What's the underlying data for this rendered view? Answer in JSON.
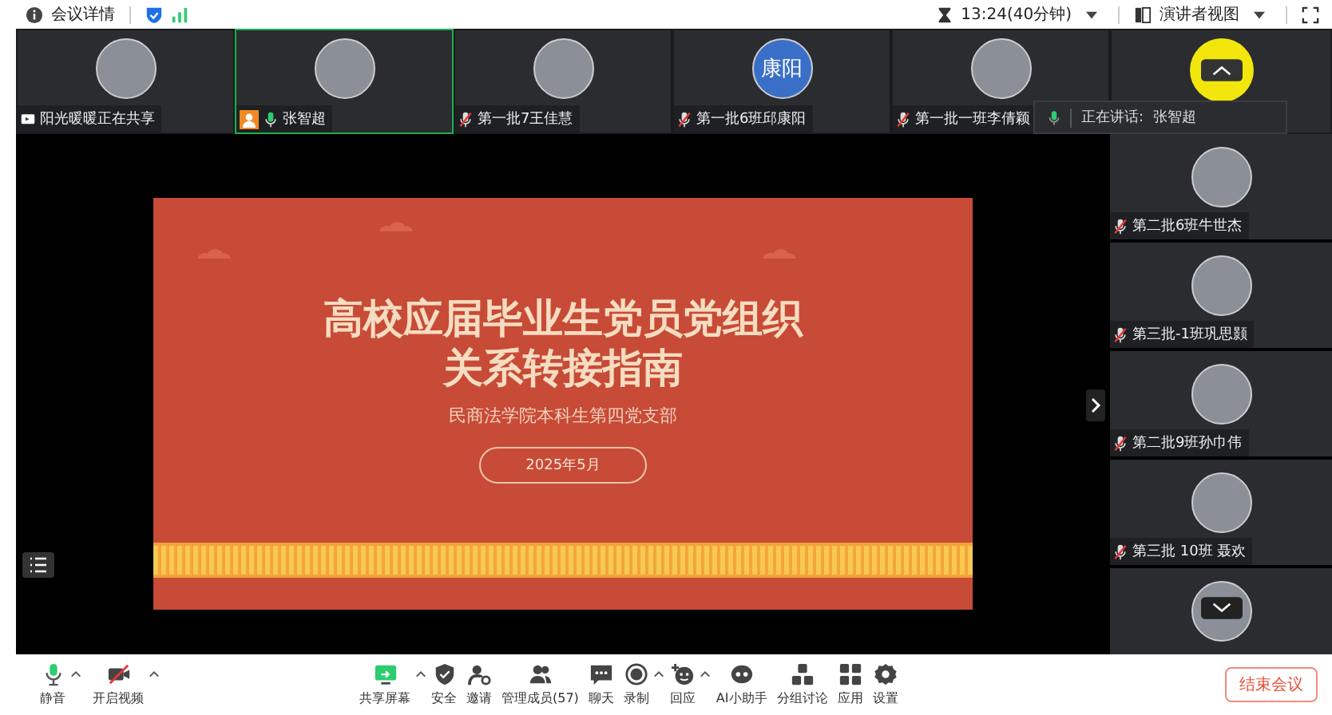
{
  "top_bar": {
    "meeting_info": "会议详情",
    "timer": "13:24(40分钟)",
    "view_mode": "演讲者视图"
  },
  "top_tiles": [
    {
      "name": "阳光暖暖正在共享",
      "sharing": true,
      "host": false,
      "selected": false
    },
    {
      "name": "张智超",
      "sharing": false,
      "muted": false,
      "host": true,
      "selected": true
    },
    {
      "name": "第一批7王佳慧",
      "sharing": false,
      "muted": true,
      "host": false,
      "selected": false
    },
    {
      "name": "第一批6班邱康阳",
      "sharing": false,
      "muted": true,
      "host": false,
      "selected": false,
      "avatar_text": "康阳"
    },
    {
      "name": "第一批一班李倩颖",
      "sharing": false,
      "muted": true,
      "host": false,
      "selected": false
    }
  ],
  "speaking": {
    "label": "正在讲话:",
    "name": "张智超"
  },
  "side_tiles": [
    {
      "name": "第二批6班牛世杰",
      "muted": true
    },
    {
      "name": "第三批-1班巩思颢",
      "muted": true
    },
    {
      "name": "第二批9班孙巾伟",
      "muted": true
    },
    {
      "name": "第三批 10班 聂欢",
      "muted": true
    }
  ],
  "slide": {
    "title_lines": [
      "高校应届毕业生党员党组织",
      "关系转接指南"
    ],
    "subtitle": "民商法学院本科生第四党支部",
    "date": "2025年5月"
  },
  "toolbar": {
    "left": [
      {
        "kind": "mic",
        "label": "静音",
        "caret": true
      },
      {
        "kind": "video",
        "label": "开启视频",
        "caret": true
      }
    ],
    "center": [
      {
        "kind": "share",
        "label": "共享屏幕",
        "caret": true
      },
      {
        "kind": "security",
        "label": "安全",
        "caret": false
      },
      {
        "kind": "invite",
        "label": "邀请",
        "caret": false
      },
      {
        "kind": "members",
        "label": "管理成员(57)",
        "caret": false
      },
      {
        "kind": "chat",
        "label": "聊天",
        "caret": false
      },
      {
        "kind": "record",
        "label": "录制",
        "caret": true
      },
      {
        "kind": "reaction",
        "label": "回应",
        "caret": true
      },
      {
        "kind": "ai",
        "label": "AI小助手",
        "caret": false
      },
      {
        "kind": "breakout",
        "label": "分组讨论",
        "caret": false
      },
      {
        "kind": "apps",
        "label": "应用",
        "caret": false
      },
      {
        "kind": "settings",
        "label": "设置",
        "caret": false
      }
    ],
    "end_button": "结束会议"
  }
}
